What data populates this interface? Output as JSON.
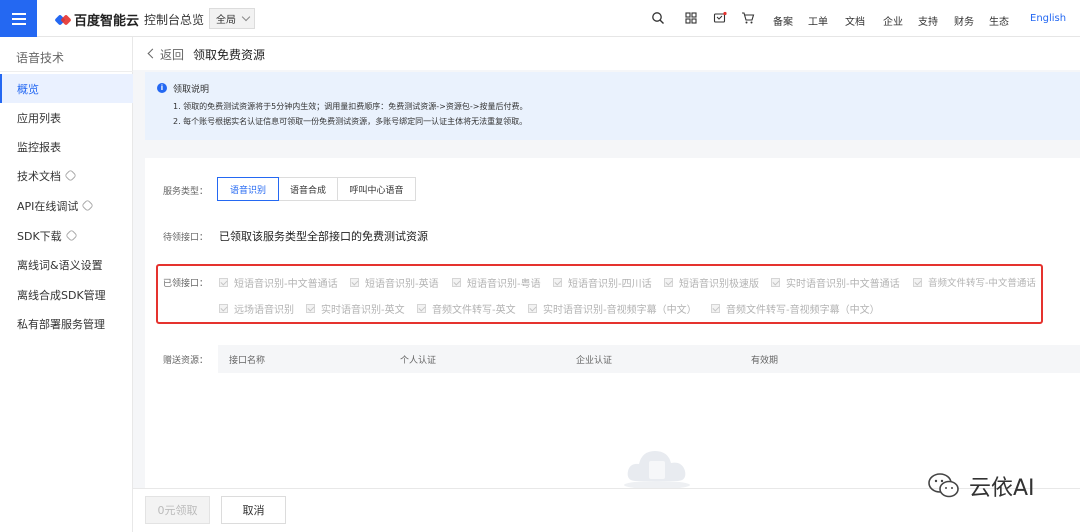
{
  "brand": {
    "name": "百度智能云"
  },
  "topbar": {
    "console_link": "控制台总览",
    "region": "全局",
    "nav": [
      "备案",
      "工单",
      "文档",
      "企业",
      "支持",
      "财务",
      "生态",
      "English"
    ]
  },
  "sidebar": {
    "title": "语音技术",
    "items": [
      {
        "label": "概览",
        "active": true
      },
      {
        "label": "应用列表"
      },
      {
        "label": "监控报表"
      },
      {
        "label": "技术文档"
      },
      {
        "label": "API在线调试"
      },
      {
        "label": "SDK下载"
      },
      {
        "label": "离线词&语义设置"
      },
      {
        "label": "离线合成SDK管理"
      },
      {
        "label": "私有部署服务管理"
      }
    ]
  },
  "header": {
    "back": "返回",
    "title": "领取免费资源"
  },
  "notice": {
    "title": "领取说明",
    "lines": [
      "1. 领取的免费测试资源将于5分钟内生效；调用量扣费顺序：免费测试资源->资源包->按量后付费。",
      "2. 每个账号根据实名认证信息可领取一份免费测试资源，多账号绑定同一认证主体将无法重复领取。"
    ]
  },
  "form": {
    "service_type_label": "服务类型：",
    "service_tabs": [
      "语音识别",
      "语音合成",
      "呼叫中心语音"
    ],
    "pending_label": "待领接口：",
    "pending_text": "已领取该服务类型全部接口的免费测试资源",
    "claimed_label": "已领接口：",
    "claimed_apis": [
      "短语音识别-中文普通话",
      "短语音识别-英语",
      "短语音识别-粤语",
      "短语音识别-四川话",
      "短语音识别极速版",
      "实时语音识别-中文普通话",
      "音频文件转写-中文普通话",
      "远场语音识别",
      "实时语音识别-英文",
      "音频文件转写-英文",
      "实时语音识别-音视频字幕（中文）",
      "音频文件转写-音视频字幕（中文）"
    ],
    "gift_label": "赠送资源：",
    "table_headers": [
      "接口名称",
      "个人认证",
      "企业认证",
      "有效期"
    ]
  },
  "footer": {
    "claim_button": "0元领取",
    "cancel_button": "取消"
  },
  "watermark": {
    "text": "云依AI"
  },
  "colors": {
    "primary": "#2468f2",
    "highlight_border": "#e5322e",
    "notice_bg": "#eaf2fd"
  }
}
